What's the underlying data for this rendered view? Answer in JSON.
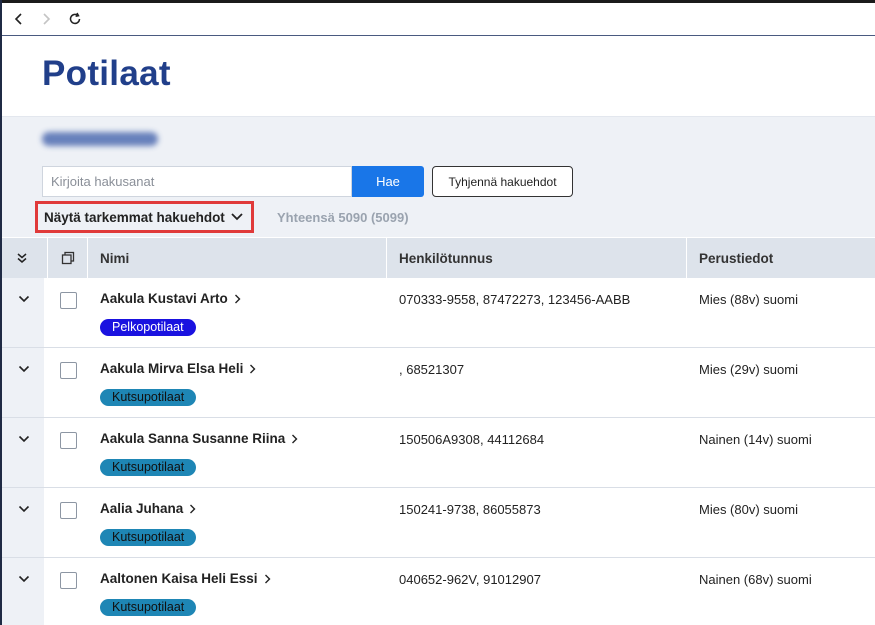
{
  "colors": {
    "accent": "#1976e8",
    "title": "#213f8a",
    "pelko_tag": "#1a12e0",
    "kutsu_tag": "#1e86b5",
    "highlight": "#e03a3a"
  },
  "browser": {
    "back_icon": "chevron-left-icon",
    "forward_icon": "chevron-right-icon",
    "reload_icon": "reload-icon"
  },
  "page": {
    "title": "Potilaat"
  },
  "search": {
    "placeholder": "Kirjoita hakusanat",
    "value": "",
    "search_button": "Hae",
    "clear_button": "Tyhjennä hakuehdot",
    "advanced_toggle": "Näytä tarkemmat hakuehdot",
    "total": "Yhteensä 5090 (5099)"
  },
  "table": {
    "columns": {
      "name": "Nimi",
      "hetu": "Henkilötunnus",
      "perus": "Perustiedot"
    },
    "rows": [
      {
        "name": "Aakula Kustavi Arto",
        "hetu": "070333-9558, 87472273, 123456-AABB",
        "perus": "Mies (88v) suomi",
        "tag": "Pelkopotilaat",
        "tag_type": "pelko"
      },
      {
        "name": "Aakula Mirva Elsa Heli",
        "hetu": ", 68521307",
        "perus": "Mies (29v) suomi",
        "tag": "Kutsupotilaat",
        "tag_type": "kutsu"
      },
      {
        "name": "Aakula Sanna Susanne Riina",
        "hetu": "150506A9308, 44112684",
        "perus": "Nainen (14v) suomi",
        "tag": "Kutsupotilaat",
        "tag_type": "kutsu"
      },
      {
        "name": "Aalia Juhana",
        "hetu": "150241-9738, 86055873",
        "perus": "Mies (80v) suomi",
        "tag": "Kutsupotilaat",
        "tag_type": "kutsu"
      },
      {
        "name": "Aaltonen Kaisa Heli Essi",
        "hetu": "040652-962V, 91012907",
        "perus": "Nainen (68v) suomi",
        "tag": "Kutsupotilaat",
        "tag_type": "kutsu"
      }
    ]
  }
}
